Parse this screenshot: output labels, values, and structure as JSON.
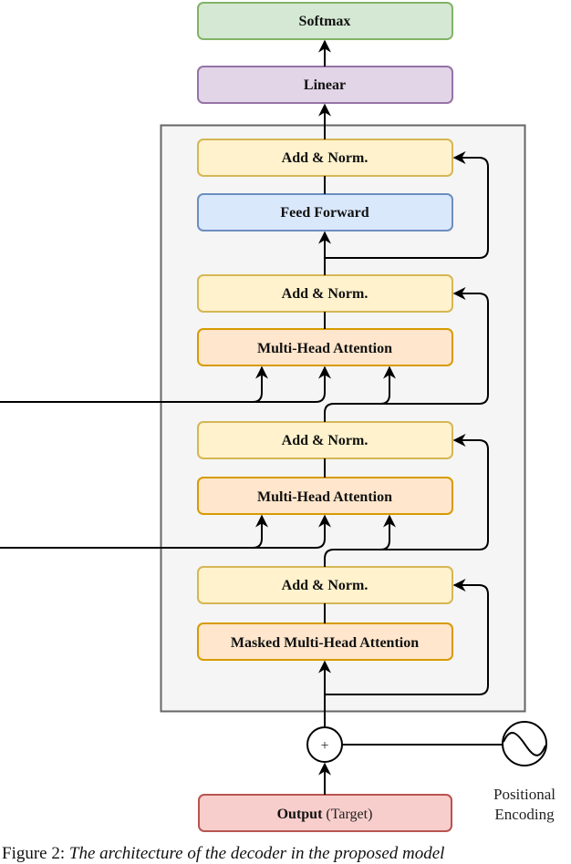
{
  "figure": {
    "caption_label": "Figure 2:",
    "caption_text": "The architecture of the decoder in the proposed model"
  },
  "blocks": {
    "softmax": "Softmax",
    "linear": "Linear",
    "add_norm_1": "Add & Norm.",
    "feed_forward": "Feed Forward",
    "add_norm_2": "Add & Norm.",
    "mha_1": "Multi-Head Attention",
    "add_norm_3": "Add & Norm.",
    "mha_2": "Multi-Head Attention",
    "add_norm_4": "Add & Norm.",
    "masked_mha": "Masked Multi-Head Attention",
    "output_bold": "Output",
    "output_rest": " (Target)"
  },
  "positional_encoding": {
    "line1": "Positional",
    "line2": "Encoding"
  },
  "sum_symbol": "+",
  "colors": {
    "softmax_fill": "#d5e8d4",
    "softmax_stroke": "#82b366",
    "linear_fill": "#e1d5e7",
    "linear_stroke": "#9673a6",
    "addnorm_fill": "#fff2cc",
    "addnorm_stroke": "#d6b656",
    "ff_fill": "#dae8fc",
    "ff_stroke": "#6c8ebf",
    "mha_fill": "#ffe6cc",
    "mha_stroke": "#d79b00",
    "output_fill": "#f8cecc",
    "output_stroke": "#b85450",
    "container_fill": "#f5f5f5",
    "container_stroke": "#666666"
  }
}
